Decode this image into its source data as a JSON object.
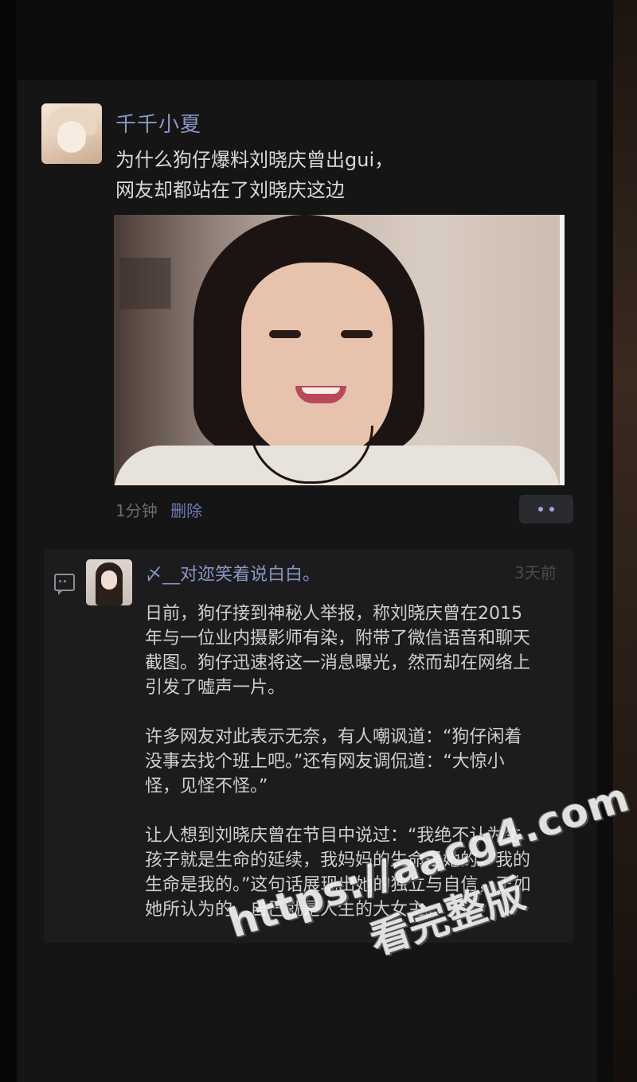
{
  "post": {
    "username": "千千小夏",
    "text_line1": "为什么狗仔爆料刘晓庆曾出gui，",
    "text_line2": "网友却都站在了刘晓庆这边",
    "time": "1分钟",
    "delete_label": "删除",
    "avatar_icon": "avatar-girl",
    "more_icon": "ellipsis-icon"
  },
  "comment": {
    "author": "〆__对迩笑着说白白。",
    "time": "3天前",
    "paragraphs": [
      "日前，狗仔接到神秘人举报，称刘晓庆曾在2015年与一位业内摄影师有染，附带了微信语音和聊天截图。狗仔迅速将这一消息曝光，然而却在网络上引发了嘘声一片。",
      "许多网友对此表示无奈，有人嘲讽道：“狗仔闲着没事去找个班上吧。”还有网友调侃道：“大惊小怪，见怪不怪。”",
      "让人想到刘晓庆曾在节目中说过：“我绝不认为生孩子就是生命的延续，我妈妈的生命是她的，我的生命是我的。”这句话展现出她的独立与自信，正如她所认为的，自己就是人生的大女主。"
    ]
  },
  "watermark": {
    "url": "https://aacg4.com",
    "tag": "看完整版"
  },
  "colors": {
    "background": "#0c0c0d",
    "card": "#151516",
    "name_link": "#8a96c4",
    "text": "#d9d9d9"
  }
}
